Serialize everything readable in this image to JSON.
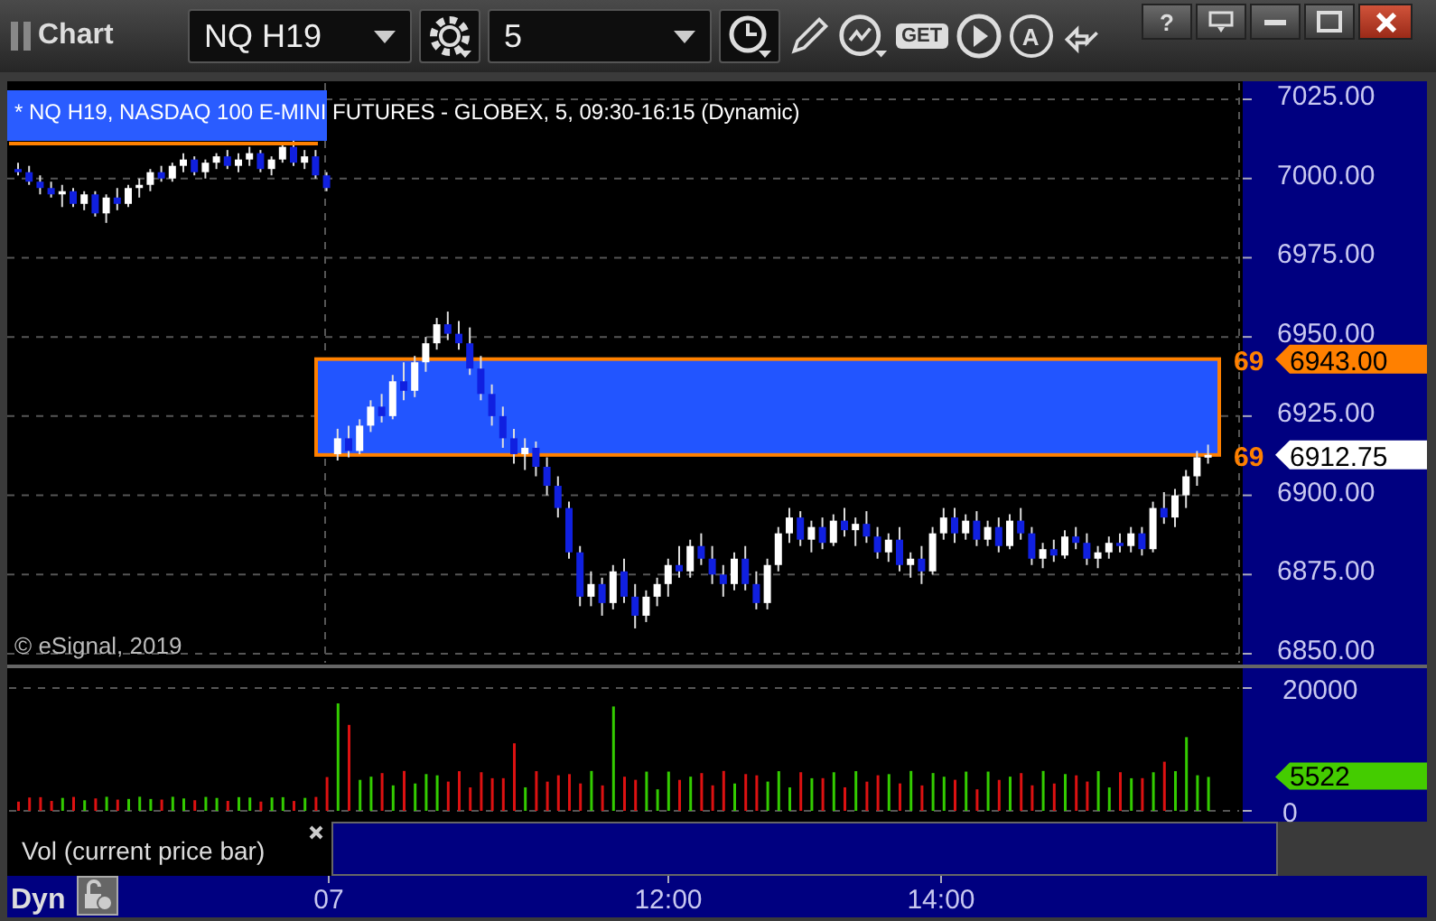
{
  "window": {
    "title": "Chart",
    "help": "?"
  },
  "toolbar": {
    "symbol": "NQ H19",
    "interval": "5",
    "get": "GET",
    "annotate": "A"
  },
  "chart": {
    "title": "* NQ H19, NASDAQ 100 E-MINI FUTURES - GLOBEX, 5, 09:30-16:15 (Dynamic)",
    "copyright": "© eSignal, 2019",
    "price_tags": [
      {
        "line_label": "69",
        "label": "6943.00",
        "color": "#ff8000"
      },
      {
        "line_label": "69",
        "label": "6912.75",
        "color": "#ffffff"
      }
    ],
    "chart_data": {
      "type": "candlestick",
      "grid": true,
      "ylim": [
        6850,
        7025
      ],
      "yticks": [
        {
          "value": 7025,
          "label": "7025.00"
        },
        {
          "value": 7000,
          "label": "7000.00"
        },
        {
          "value": 6975,
          "label": "6975.00"
        },
        {
          "value": 6950,
          "label": "6950.00"
        },
        {
          "value": 6925,
          "label": "6925.00"
        },
        {
          "value": 6900,
          "label": "6900.00"
        },
        {
          "value": 6875,
          "label": "6875.00"
        },
        {
          "value": 6850,
          "label": "6850.00"
        }
      ],
      "ohlc": [
        [
          7003,
          7005,
          7001,
          7002
        ],
        [
          7002,
          7004,
          6998,
          6999
        ],
        [
          6999,
          7001,
          6995,
          6997
        ],
        [
          6997,
          6999,
          6994,
          6995
        ],
        [
          6995,
          6998,
          6991,
          6996
        ],
        [
          6996,
          6997,
          6991,
          6992
        ],
        [
          6992,
          6996,
          6990,
          6995
        ],
        [
          6995,
          6996,
          6988,
          6989
        ],
        [
          6989,
          6995,
          6986,
          6994
        ],
        [
          6994,
          6997,
          6990,
          6992
        ],
        [
          6992,
          6998,
          6991,
          6997
        ],
        [
          6997,
          7000,
          6994,
          6998
        ],
        [
          6998,
          7003,
          6996,
          7002
        ],
        [
          7002,
          7004,
          6999,
          7000
        ],
        [
          7000,
          7005,
          6999,
          7004
        ],
        [
          7004,
          7008,
          7002,
          7006
        ],
        [
          7006,
          7007,
          7001,
          7002
        ],
        [
          7002,
          7006,
          7000,
          7005
        ],
        [
          7005,
          7008,
          7003,
          7007
        ],
        [
          7007,
          7009,
          7003,
          7004
        ],
        [
          7004,
          7008,
          7002,
          7006
        ],
        [
          7006,
          7010,
          7004,
          7008
        ],
        [
          7008,
          7009,
          7002,
          7003
        ],
        [
          7003,
          7007,
          7001,
          7006
        ],
        [
          7006,
          7011,
          7005,
          7010
        ],
        [
          7010,
          7012,
          7004,
          7005
        ],
        [
          7005,
          7009,
          7003,
          7007
        ],
        [
          7007,
          7009,
          7000,
          7001
        ],
        [
          7001,
          7002,
          6996,
          6997
        ],
        [
          6913,
          6921,
          6911,
          6918
        ],
        [
          6918,
          6922,
          6912,
          6914
        ],
        [
          6914,
          6924,
          6913,
          6922
        ],
        [
          6922,
          6930,
          6920,
          6928
        ],
        [
          6928,
          6932,
          6923,
          6925
        ],
        [
          6925,
          6938,
          6924,
          6936
        ],
        [
          6936,
          6942,
          6930,
          6933
        ],
        [
          6933,
          6944,
          6931,
          6942
        ],
        [
          6942,
          6950,
          6939,
          6948
        ],
        [
          6948,
          6956,
          6946,
          6954
        ],
        [
          6954,
          6958,
          6949,
          6951
        ],
        [
          6951,
          6955,
          6946,
          6948
        ],
        [
          6948,
          6953,
          6938,
          6940
        ],
        [
          6940,
          6944,
          6930,
          6932
        ],
        [
          6932,
          6935,
          6922,
          6925
        ],
        [
          6925,
          6928,
          6915,
          6918
        ],
        [
          6918,
          6921,
          6910,
          6913
        ],
        [
          6913,
          6918,
          6908,
          6915
        ],
        [
          6915,
          6917,
          6906,
          6909
        ],
        [
          6909,
          6912,
          6900,
          6903
        ],
        [
          6903,
          6906,
          6893,
          6896
        ],
        [
          6896,
          6898,
          6880,
          6882
        ],
        [
          6882,
          6884,
          6865,
          6868
        ],
        [
          6868,
          6876,
          6865,
          6872
        ],
        [
          6872,
          6874,
          6862,
          6866
        ],
        [
          6866,
          6878,
          6864,
          6876
        ],
        [
          6876,
          6880,
          6866,
          6868
        ],
        [
          6868,
          6872,
          6858,
          6862
        ],
        [
          6862,
          6870,
          6860,
          6868
        ],
        [
          6868,
          6874,
          6865,
          6872
        ],
        [
          6872,
          6880,
          6868,
          6878
        ],
        [
          6878,
          6884,
          6874,
          6876
        ],
        [
          6876,
          6886,
          6874,
          6884
        ],
        [
          6884,
          6888,
          6878,
          6880
        ],
        [
          6880,
          6884,
          6872,
          6875
        ],
        [
          6875,
          6878,
          6868,
          6872
        ],
        [
          6872,
          6882,
          6870,
          6880
        ],
        [
          6880,
          6884,
          6870,
          6872
        ],
        [
          6872,
          6876,
          6864,
          6866
        ],
        [
          6866,
          6880,
          6864,
          6878
        ],
        [
          6878,
          6890,
          6876,
          6888
        ],
        [
          6888,
          6896,
          6885,
          6893
        ],
        [
          6893,
          6895,
          6884,
          6886
        ],
        [
          6886,
          6892,
          6882,
          6890
        ],
        [
          6890,
          6893,
          6883,
          6885
        ],
        [
          6885,
          6894,
          6884,
          6892
        ],
        [
          6892,
          6896,
          6887,
          6889
        ],
        [
          6889,
          6893,
          6884,
          6891
        ],
        [
          6891,
          6895,
          6885,
          6887
        ],
        [
          6887,
          6890,
          6880,
          6882
        ],
        [
          6882,
          6888,
          6879,
          6886
        ],
        [
          6886,
          6890,
          6876,
          6878
        ],
        [
          6878,
          6882,
          6874,
          6880
        ],
        [
          6880,
          6884,
          6872,
          6876
        ],
        [
          6876,
          6890,
          6875,
          6888
        ],
        [
          6888,
          6896,
          6886,
          6893
        ],
        [
          6893,
          6896,
          6885,
          6888
        ],
        [
          6888,
          6894,
          6886,
          6892
        ],
        [
          6892,
          6895,
          6884,
          6886
        ],
        [
          6886,
          6892,
          6884,
          6890
        ],
        [
          6890,
          6893,
          6882,
          6884
        ],
        [
          6884,
          6894,
          6883,
          6892
        ],
        [
          6892,
          6896,
          6886,
          6888
        ],
        [
          6888,
          6890,
          6878,
          6880
        ],
        [
          6880,
          6885,
          6877,
          6883
        ],
        [
          6883,
          6886,
          6879,
          6881
        ],
        [
          6881,
          6889,
          6880,
          6887
        ],
        [
          6887,
          6890,
          6883,
          6885
        ],
        [
          6885,
          6888,
          6878,
          6880
        ],
        [
          6880,
          6884,
          6877,
          6882
        ],
        [
          6882,
          6887,
          6880,
          6885
        ],
        [
          6885,
          6888,
          6882,
          6884
        ],
        [
          6884,
          6890,
          6882,
          6888
        ],
        [
          6888,
          6890,
          6881,
          6883
        ],
        [
          6883,
          6898,
          6882,
          6896
        ],
        [
          6896,
          6901,
          6891,
          6893
        ],
        [
          6893,
          6902,
          6890,
          6900
        ],
        [
          6900,
          6908,
          6896,
          6906
        ],
        [
          6906,
          6914,
          6903,
          6912
        ],
        [
          6912,
          6916,
          6910,
          6912.75
        ]
      ]
    },
    "volume_axis": [
      "20000",
      "0"
    ],
    "volume_tag": "5522",
    "study_legend": "Vol (current price bar)",
    "mode": "Dyn",
    "time_axis": [
      "07",
      "12:00",
      "14:00"
    ]
  }
}
